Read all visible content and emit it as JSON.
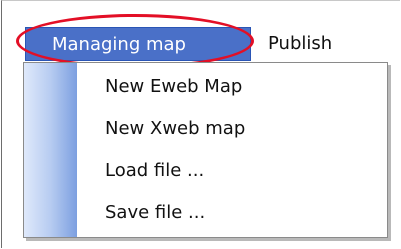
{
  "menubar": {
    "active_menu_label": "Managing map",
    "other_menu_label": "Publish"
  },
  "dropdown": {
    "items": [
      {
        "label": "New Eweb Map"
      },
      {
        "label": "New Xweb map"
      },
      {
        "label": "Load file ..."
      },
      {
        "label": "Save file ..."
      }
    ]
  },
  "colors": {
    "active_menu_bg": "#4a70c8",
    "highlight_ellipse": "#e30f26",
    "menu_strip": "#7c9fe0"
  }
}
